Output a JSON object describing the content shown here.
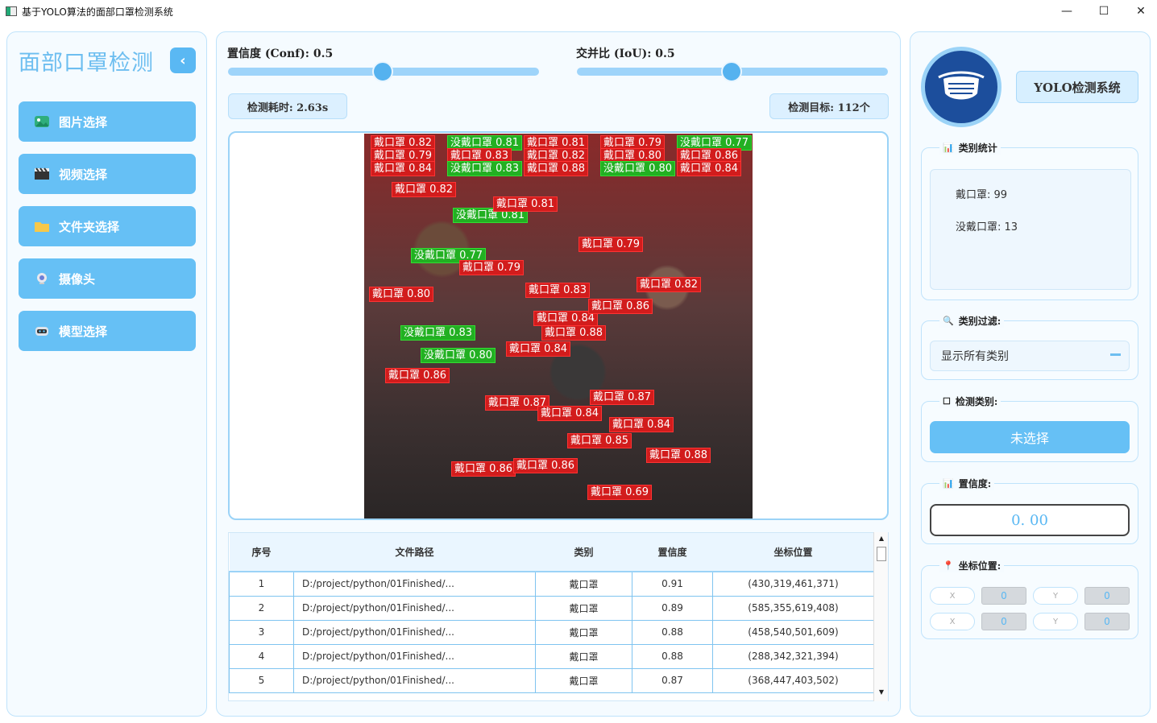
{
  "window": {
    "title": "基于YOLO算法的面部口罩检测系统",
    "minimize_glyph": "—",
    "maximize_glyph": "☐",
    "close_glyph": "✕"
  },
  "sidebar": {
    "title": "面部口罩检测",
    "collapse_glyph": "‹",
    "items": [
      {
        "label": "图片选择",
        "icon": "image-icon"
      },
      {
        "label": "视频选择",
        "icon": "clapperboard-icon"
      },
      {
        "label": "文件夹选择",
        "icon": "folder-icon"
      },
      {
        "label": "摄像头",
        "icon": "webcam-icon"
      },
      {
        "label": "模型选择",
        "icon": "robot-icon"
      }
    ]
  },
  "controls": {
    "conf_label": "置信度 (Conf): 0.5",
    "conf_value": 0.5,
    "iou_label": "交并比 (IoU): 0.5",
    "iou_value": 0.5,
    "time_badge": "检测耗时: 2.63s",
    "targets_badge": "检测目标: 112个"
  },
  "detections_preview": {
    "labels": [
      {
        "text": "戴口罩 0.82",
        "cls": "red"
      },
      {
        "text": "没戴口罩 0.81",
        "cls": "green"
      },
      {
        "text": "戴口罩 0.81",
        "cls": "red"
      },
      {
        "text": "戴口罩 0.79",
        "cls": "red"
      },
      {
        "text": "没戴口罩 0.77",
        "cls": "green"
      },
      {
        "text": "戴口罩 0.79",
        "cls": "red"
      },
      {
        "text": "戴口罩 0.83",
        "cls": "red"
      },
      {
        "text": "戴口罩 0.82",
        "cls": "red"
      },
      {
        "text": "戴口罩 0.80",
        "cls": "red"
      },
      {
        "text": "戴口罩 0.86",
        "cls": "red"
      },
      {
        "text": "戴口罩 0.84",
        "cls": "red"
      },
      {
        "text": "没戴口罩 0.83",
        "cls": "green"
      },
      {
        "text": "戴口罩 0.88",
        "cls": "red"
      },
      {
        "text": "没戴口罩 0.80",
        "cls": "green"
      },
      {
        "text": "戴口罩 0.84",
        "cls": "red"
      },
      {
        "text": "戴口罩 0.86",
        "cls": "red"
      },
      {
        "text": "戴口罩 0.87",
        "cls": "red"
      },
      {
        "text": "戴口罩 0.87",
        "cls": "red"
      },
      {
        "text": "戴口罩 0.84",
        "cls": "red"
      },
      {
        "text": "戴口罩 0.84",
        "cls": "red"
      },
      {
        "text": "戴口罩 0.85",
        "cls": "red"
      },
      {
        "text": "戴口罩 0.88",
        "cls": "red"
      },
      {
        "text": "戴口罩 0.86",
        "cls": "red"
      },
      {
        "text": "戴口罩 0.86",
        "cls": "red"
      },
      {
        "text": "戴口罩 0.69",
        "cls": "red"
      }
    ]
  },
  "table": {
    "headers": [
      "序号",
      "文件路径",
      "类别",
      "置信度",
      "坐标位置"
    ],
    "rows": [
      [
        "1",
        "D:/project/python/01Finished/...",
        "戴口罩",
        "0.91",
        "(430,319,461,371)"
      ],
      [
        "2",
        "D:/project/python/01Finished/...",
        "戴口罩",
        "0.89",
        "(585,355,619,408)"
      ],
      [
        "3",
        "D:/project/python/01Finished/...",
        "戴口罩",
        "0.88",
        "(458,540,501,609)"
      ],
      [
        "4",
        "D:/project/python/01Finished/...",
        "戴口罩",
        "0.88",
        "(288,342,321,394)"
      ],
      [
        "5",
        "D:/project/python/01Finished/...",
        "戴口罩",
        "0.87",
        "(368,447,403,502)"
      ]
    ]
  },
  "right": {
    "brand": "YOLO检测系统",
    "stats_title": "类别统计",
    "stats": [
      "戴口罩: 99",
      "没戴口罩: 13"
    ],
    "filter_title": "类别过滤:",
    "filter_value": "显示所有类别",
    "detect_class_title": "检测类别:",
    "detect_class_value": "未选择",
    "conf_title": "置信度:",
    "conf_value": "0. 00",
    "coord_title": "坐标位置:",
    "coords": {
      "row1": {
        "x_label": "X",
        "x_value": "0",
        "y_label": "Y",
        "y_value": "0"
      },
      "row2": {
        "x_label": "X",
        "x_value": "0",
        "y_label": "Y",
        "y_value": "0"
      }
    }
  },
  "colors": {
    "accent": "#66c0f5",
    "mask_box": "#d21c1c",
    "nomask_box": "#22b022",
    "panel_border": "#bfe3fb"
  }
}
